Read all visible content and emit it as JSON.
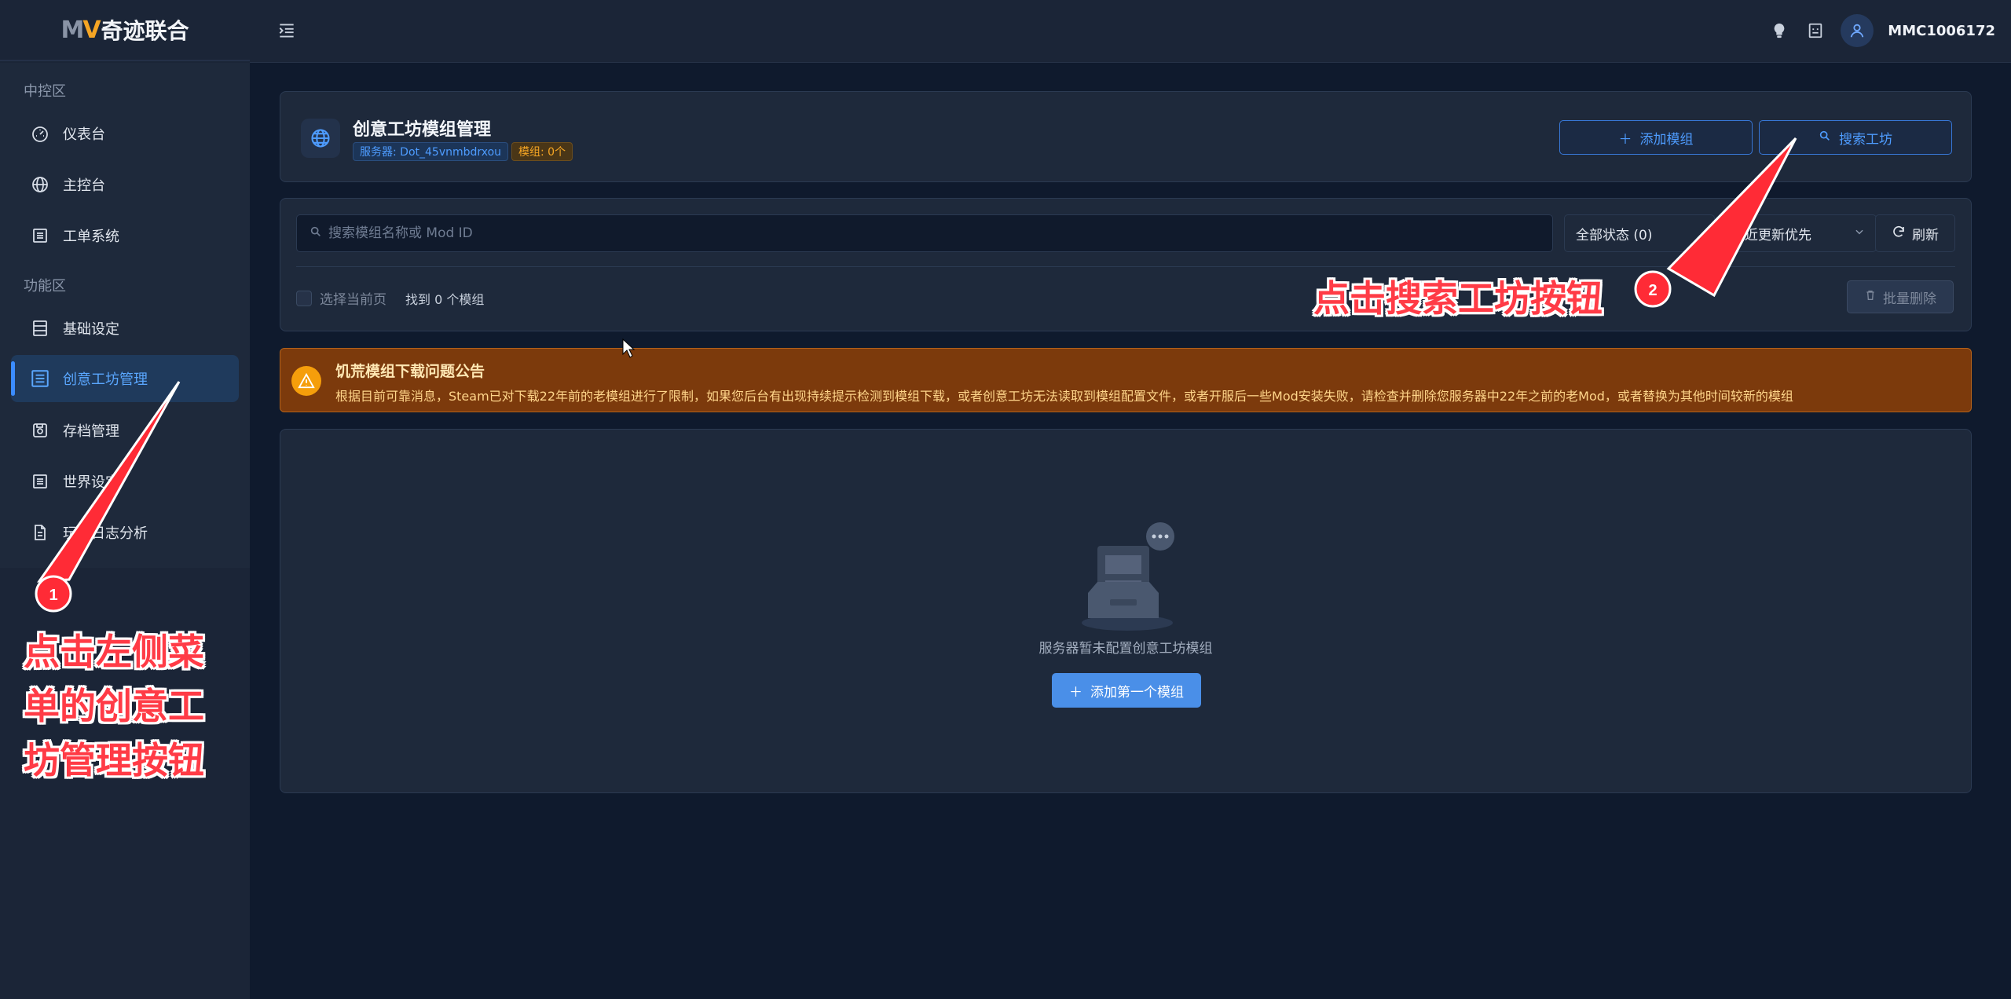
{
  "app": {
    "logo_mv_m": "M",
    "logo_mv_v": "V",
    "logo_text": "奇迹联合",
    "username": "MMC1006172"
  },
  "sidebar": {
    "section1": "中控区",
    "section2": "功能区",
    "items": [
      {
        "label": "仪表台",
        "icon": "dashboard-icon"
      },
      {
        "label": "主控台",
        "icon": "globe-icon"
      },
      {
        "label": "工单系统",
        "icon": "list-icon"
      },
      {
        "label": "基础设定",
        "icon": "server-icon"
      },
      {
        "label": "创意工坊管理",
        "icon": "workshop-icon",
        "active": true
      },
      {
        "label": "存档管理",
        "icon": "save-icon"
      },
      {
        "label": "世界设定",
        "icon": "list-icon"
      },
      {
        "label": "玩家日志分析",
        "icon": "file-icon"
      }
    ]
  },
  "header": {
    "title": "创意工坊模组管理",
    "server_tag": "服务器: Dot_45vnmbdrxou",
    "mods_tag": "模组: 0个",
    "add_mod": "添加模组",
    "search_workshop": "搜索工坊"
  },
  "filter": {
    "search_placeholder": "搜索模组名称或 Mod ID",
    "status_select": "全部状态 (0)",
    "sort_select": "最近更新优先",
    "refresh": "刷新",
    "select_page": "选择当前页",
    "found": "找到 0 个模组",
    "batch_delete": "批量删除"
  },
  "notice": {
    "title": "饥荒模组下载问题公告",
    "body": "根据目前可靠消息，Steam已对下载22年前的老模组进行了限制，如果您后台有出现持续提示检测到模组下载，或者创意工坊无法读取到模组配置文件，或者开服后一些Mod安装失败，请检查并删除您服务器中22年之前的老Mod，或者替换为其他时间较新的模组"
  },
  "empty": {
    "text": "服务器暂未配置创意工坊模组",
    "button": "添加第一个模组"
  },
  "annotations": {
    "step1_line1": "点击左侧菜",
    "step1_line2": "单的创意工",
    "step1_line3": "坊管理按钮",
    "step1_num": "1",
    "step2_text": "点击搜索工坊按钮",
    "step2_num": "2"
  },
  "colors": {
    "accent": "#4e9cff",
    "warning": "#f59e0b",
    "annotation": "#ff3b46"
  }
}
